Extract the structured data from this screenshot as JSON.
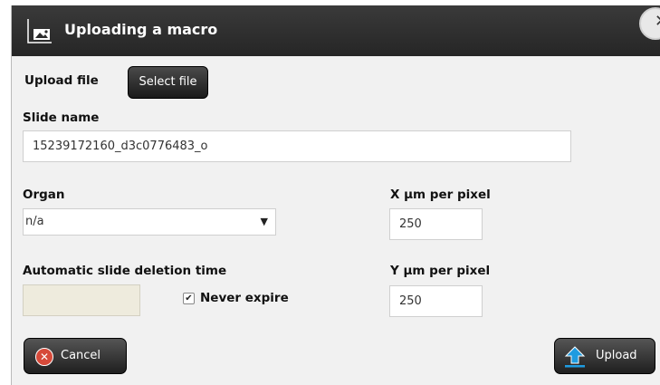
{
  "dialog": {
    "title": "Uploading a macro",
    "close_symbol": "✕"
  },
  "upload_file": {
    "label": "Upload file",
    "button_label": "Select file"
  },
  "slide_name": {
    "label": "Slide name",
    "value": "15239172160_d3c0776483_o"
  },
  "organ": {
    "label": "Organ",
    "selected": "n/a"
  },
  "x_um_per_pixel": {
    "label": "X µm per pixel",
    "value": "250"
  },
  "y_um_per_pixel": {
    "label": "Y µm per pixel",
    "value": "250"
  },
  "deletion": {
    "label": "Automatic slide deletion time",
    "value": "",
    "never_expire_label": "Never expire",
    "never_expire_checked": true
  },
  "footer": {
    "cancel_label": "Cancel",
    "upload_label": "Upload"
  },
  "icons": {
    "title": "image-upload-icon",
    "close": "close-icon",
    "cancel": "cancel-icon",
    "upload": "upload-arrow-icon"
  },
  "colors": {
    "titlebar": "#2b2b2b",
    "cancel_icon": "#d64a3a",
    "upload_icon": "#1e9be0"
  }
}
